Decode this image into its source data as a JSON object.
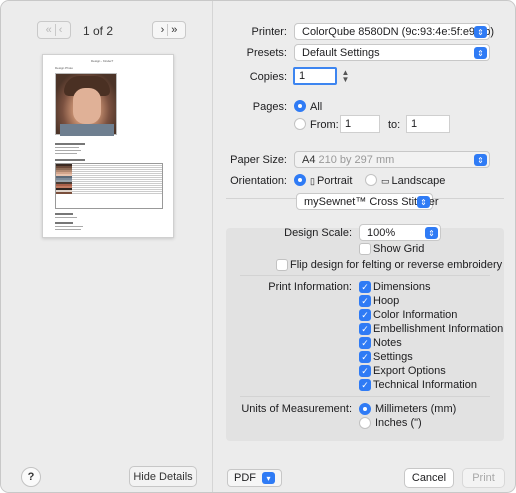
{
  "preview": {
    "page_indicator": "1 of 2",
    "nav_first": "«",
    "nav_prev": "‹",
    "nav_next": "›",
    "nav_last": "»",
    "page_title": "Design - Kinder7",
    "photo_heading": "Design Photo"
  },
  "left_footer": {
    "help_label": "?",
    "hide_details_label": "Hide Details"
  },
  "printer": {
    "label": "Printer:",
    "value": "ColorQube 8580DN (9c:93:4e:5f:e9:5b)"
  },
  "presets": {
    "label": "Presets:",
    "value": "Default Settings"
  },
  "copies": {
    "label": "Copies:",
    "value": "1"
  },
  "pages": {
    "label": "Pages:",
    "all_label": "All",
    "from_label": "From:",
    "from_value": "1",
    "to_label": "to:",
    "to_value": "1"
  },
  "paper_size": {
    "label": "Paper Size:",
    "value": "A4",
    "detail": "210 by 297 mm"
  },
  "orientation": {
    "label": "Orientation:",
    "portrait_label": "Portrait",
    "landscape_label": "Landscape"
  },
  "plugin": {
    "value": "mySewnet™ Cross Stitcher",
    "design_scale_label": "Design Scale:",
    "design_scale_value": "100%",
    "show_grid_label": "Show Grid",
    "flip_label": "Flip design for felting or reverse embroidery",
    "print_info_label": "Print Information:",
    "print_info_items": [
      "Dimensions",
      "Hoop",
      "Color Information",
      "Embellishment Information",
      "Notes",
      "Settings",
      "Export Options",
      "Technical Information"
    ],
    "units_label": "Units of Measurement:",
    "units_mm_label": "Millimeters (mm)",
    "units_in_label": "Inches (\")"
  },
  "footer": {
    "pdf_label": "PDF",
    "cancel_label": "Cancel",
    "print_label": "Print"
  },
  "colors": {
    "accent": "#2f7bf5",
    "panel_bg": "#ececec",
    "plugin_bg": "#e2e2e2"
  }
}
